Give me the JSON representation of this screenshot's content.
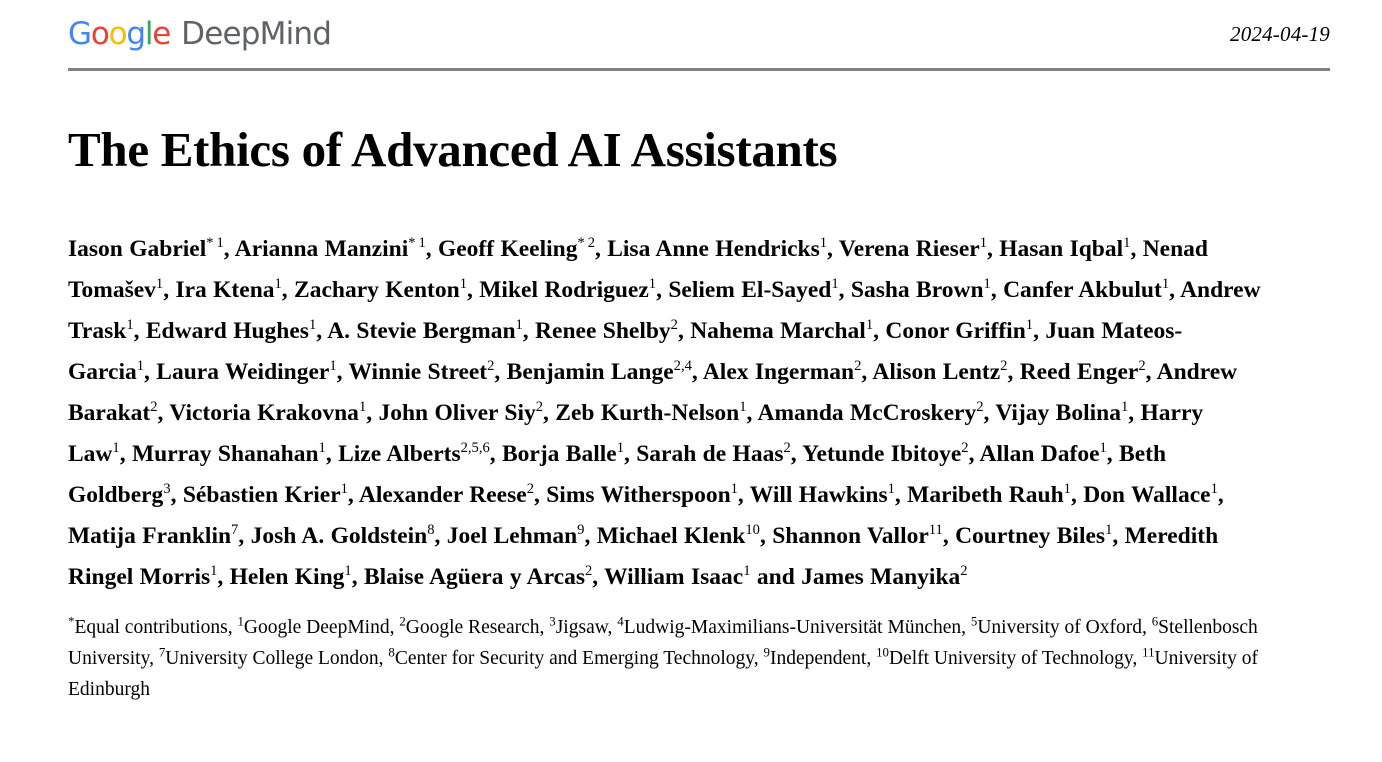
{
  "header": {
    "logo": {
      "google_letters": [
        {
          "ch": "G",
          "color": "#4285F4"
        },
        {
          "ch": "o",
          "color": "#EA4335"
        },
        {
          "ch": "o",
          "color": "#FBBC05"
        },
        {
          "ch": "g",
          "color": "#4285F4"
        },
        {
          "ch": "l",
          "color": "#34A853"
        },
        {
          "ch": "e",
          "color": "#EA4335"
        }
      ],
      "google_text": "Google",
      "deepmind_text": "DeepMind",
      "deepmind_color": "#5F6368"
    },
    "date": "2024-04-19"
  },
  "title": "The Ethics of Advanced AI Assistants",
  "authors": [
    {
      "name": "Iason Gabriel",
      "star": true,
      "affil": "1"
    },
    {
      "name": "Arianna Manzini",
      "star": true,
      "affil": "1"
    },
    {
      "name": "Geoff Keeling",
      "star": true,
      "affil": "2"
    },
    {
      "name": "Lisa Anne Hendricks",
      "star": false,
      "affil": "1"
    },
    {
      "name": "Verena Rieser",
      "star": false,
      "affil": "1"
    },
    {
      "name": "Hasan Iqbal",
      "star": false,
      "affil": "1"
    },
    {
      "name": "Nenad Tomašev",
      "star": false,
      "affil": "1"
    },
    {
      "name": "Ira Ktena",
      "star": false,
      "affil": "1"
    },
    {
      "name": "Zachary Kenton",
      "star": false,
      "affil": "1"
    },
    {
      "name": "Mikel Rodriguez",
      "star": false,
      "affil": "1"
    },
    {
      "name": "Seliem El-Sayed",
      "star": false,
      "affil": "1"
    },
    {
      "name": "Sasha Brown",
      "star": false,
      "affil": "1"
    },
    {
      "name": "Canfer Akbulut",
      "star": false,
      "affil": "1"
    },
    {
      "name": "Andrew Trask",
      "star": false,
      "affil": "1"
    },
    {
      "name": "Edward Hughes",
      "star": false,
      "affil": "1"
    },
    {
      "name": "A. Stevie Bergman",
      "star": false,
      "affil": "1"
    },
    {
      "name": "Renee Shelby",
      "star": false,
      "affil": "2"
    },
    {
      "name": "Nahema Marchal",
      "star": false,
      "affil": "1"
    },
    {
      "name": "Conor Griffin",
      "star": false,
      "affil": "1"
    },
    {
      "name": "Juan Mateos-Garcia",
      "star": false,
      "affil": "1"
    },
    {
      "name": "Laura Weidinger",
      "star": false,
      "affil": "1"
    },
    {
      "name": "Winnie Street",
      "star": false,
      "affil": "2"
    },
    {
      "name": "Benjamin Lange",
      "star": false,
      "affil": "2,4"
    },
    {
      "name": "Alex Ingerman",
      "star": false,
      "affil": "2"
    },
    {
      "name": "Alison Lentz",
      "star": false,
      "affil": "2"
    },
    {
      "name": "Reed Enger",
      "star": false,
      "affil": "2"
    },
    {
      "name": "Andrew Barakat",
      "star": false,
      "affil": "2"
    },
    {
      "name": "Victoria Krakovna",
      "star": false,
      "affil": "1"
    },
    {
      "name": "John Oliver Siy",
      "star": false,
      "affil": "2"
    },
    {
      "name": "Zeb Kurth-Nelson",
      "star": false,
      "affil": "1"
    },
    {
      "name": "Amanda McCroskery",
      "star": false,
      "affil": "2"
    },
    {
      "name": "Vijay Bolina",
      "star": false,
      "affil": "1"
    },
    {
      "name": "Harry Law",
      "star": false,
      "affil": "1"
    },
    {
      "name": "Murray Shanahan",
      "star": false,
      "affil": "1"
    },
    {
      "name": "Lize Alberts",
      "star": false,
      "affil": "2,5,6"
    },
    {
      "name": "Borja Balle",
      "star": false,
      "affil": "1"
    },
    {
      "name": "Sarah de Haas",
      "star": false,
      "affil": "2"
    },
    {
      "name": "Yetunde Ibitoye",
      "star": false,
      "affil": "2"
    },
    {
      "name": "Allan Dafoe",
      "star": false,
      "affil": "1"
    },
    {
      "name": "Beth Goldberg",
      "star": false,
      "affil": "3"
    },
    {
      "name": "Sébastien Krier",
      "star": false,
      "affil": "1"
    },
    {
      "name": "Alexander Reese",
      "star": false,
      "affil": "2"
    },
    {
      "name": "Sims Witherspoon",
      "star": false,
      "affil": "1"
    },
    {
      "name": "Will Hawkins",
      "star": false,
      "affil": "1"
    },
    {
      "name": "Maribeth Rauh",
      "star": false,
      "affil": "1"
    },
    {
      "name": "Don Wallace",
      "star": false,
      "affil": "1"
    },
    {
      "name": "Matija Franklin",
      "star": false,
      "affil": "7"
    },
    {
      "name": "Josh A. Goldstein",
      "star": false,
      "affil": "8"
    },
    {
      "name": "Joel Lehman",
      "star": false,
      "affil": "9"
    },
    {
      "name": "Michael Klenk",
      "star": false,
      "affil": "10"
    },
    {
      "name": "Shannon Vallor",
      "star": false,
      "affil": "11"
    },
    {
      "name": "Courtney Biles",
      "star": false,
      "affil": "1"
    },
    {
      "name": "Meredith Ringel Morris",
      "star": false,
      "affil": "1"
    },
    {
      "name": "Helen King",
      "star": false,
      "affil": "1"
    },
    {
      "name": "Blaise Agüera y Arcas",
      "star": false,
      "affil": "2"
    },
    {
      "name": "William Isaac",
      "star": false,
      "affil": "1"
    },
    {
      "name": "James Manyika",
      "star": false,
      "affil": "2",
      "conjunction": "and"
    }
  ],
  "affiliations": {
    "equal_contributions_marker": "*",
    "equal_contributions_text": "Equal contributions",
    "entries": [
      {
        "num": "1",
        "name": "Google DeepMind"
      },
      {
        "num": "2",
        "name": "Google Research"
      },
      {
        "num": "3",
        "name": "Jigsaw"
      },
      {
        "num": "4",
        "name": "Ludwig-Maximilians-Universität München"
      },
      {
        "num": "5",
        "name": "University of Oxford"
      },
      {
        "num": "6",
        "name": "Stellenbosch University"
      },
      {
        "num": "7",
        "name": "University College London"
      },
      {
        "num": "8",
        "name": "Center for Security and Emerging Technology"
      },
      {
        "num": "9",
        "name": "Independent"
      },
      {
        "num": "10",
        "name": "Delft University of Technology"
      },
      {
        "num": "11",
        "name": "University of Edinburgh"
      }
    ]
  }
}
